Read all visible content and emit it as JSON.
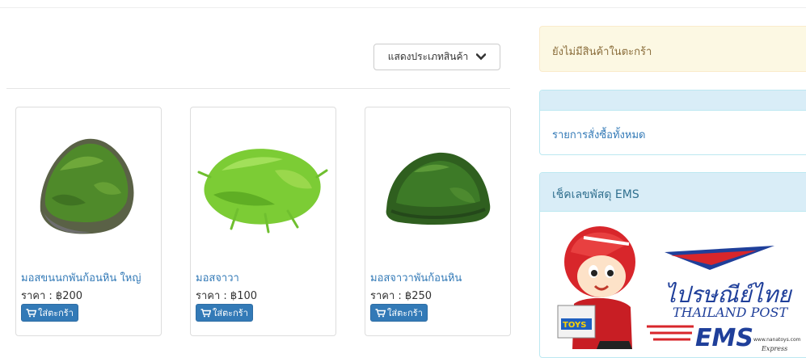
{
  "filter": {
    "category_button": "แสดงประเภทสินค้า",
    "icon": "chevron-down-icon"
  },
  "products": [
    {
      "name": "มอสขนนกพันก้อนหิน ใหญ่",
      "price_label": "ราคา : ฿200",
      "add_label": "ใส่ตะกร้า",
      "icon": "cart-icon"
    },
    {
      "name": "มอสจาวา",
      "price_label": "ราคา : ฿100",
      "add_label": "ใส่ตะกร้า",
      "icon": "cart-icon"
    },
    {
      "name": "มอสจาวาพันก้อนหิน",
      "price_label": "ราคา : ฿250",
      "add_label": "ใส่ตะกร้า",
      "icon": "cart-icon"
    }
  ],
  "sidebar": {
    "cart_empty": "ยังไม่มีสินค้าในตะกร้า",
    "orders_link": "รายการสั่งซื้อทั้งหมด",
    "ems_heading": "เช็คเลขพัสดุ EMS",
    "ems_banner": {
      "logo_thai": "ไปรษณีย์ไทย",
      "logo_en": "THAILAND POST",
      "ems": "EMS",
      "website": "www.nanatoys.com",
      "express": "Express",
      "box_text": "TOYS"
    }
  },
  "colors": {
    "accent": "#337ab7",
    "warning_bg": "#fcf8e3",
    "info_bg": "#d9edf7",
    "moss": "#4f8a2a"
  }
}
